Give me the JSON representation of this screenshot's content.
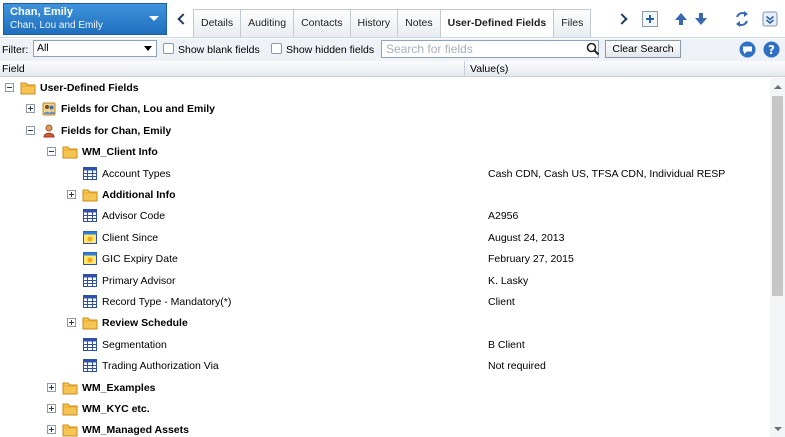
{
  "header": {
    "client_name": "Chan, Emily",
    "client_household": "Chan, Lou and Emily",
    "tabs": [
      {
        "label": "Details"
      },
      {
        "label": "Auditing"
      },
      {
        "label": "Contacts"
      },
      {
        "label": "History"
      },
      {
        "label": "Notes"
      },
      {
        "label": "User-Defined Fields",
        "active": true
      },
      {
        "label": "Files"
      }
    ],
    "icons": [
      "chevron-left-icon",
      "chevron-right-icon",
      "add-tab-icon",
      "arrow-up-icon",
      "arrow-down-icon",
      "refresh-icon",
      "collapse-icon"
    ]
  },
  "filterbar": {
    "filter_label": "Filter:",
    "filter_value": "All",
    "show_blank_label": "Show blank fields",
    "show_hidden_label": "Show hidden fields",
    "search_placeholder": "Search for fields",
    "clear_search_label": "Clear Search"
  },
  "columns": {
    "field": "Field",
    "values": "Value(s)"
  },
  "tree": {
    "rows": [
      {
        "label": "User-Defined Fields",
        "value": "",
        "level": 0,
        "icon": "folder-icon",
        "expander": "minus",
        "bold": true
      },
      {
        "label": "Fields for Chan, Lou and Emily",
        "value": "",
        "level": 1,
        "icon": "household-icon",
        "expander": "plus",
        "bold": true
      },
      {
        "label": "Fields for Chan, Emily",
        "value": "",
        "level": 1,
        "icon": "person-icon",
        "expander": "minus",
        "bold": true
      },
      {
        "label": "WM_Client Info",
        "value": "",
        "level": 2,
        "icon": "folder-icon",
        "expander": "minus",
        "bold": true
      },
      {
        "label": "Account Types",
        "value": "Cash CDN, Cash US, TFSA CDN, Individual RESP",
        "level": 3,
        "icon": "grid-field-icon"
      },
      {
        "label": "Additional Info",
        "value": "",
        "level": 3,
        "icon": "folder-icon",
        "expander": "plus",
        "bold": true
      },
      {
        "label": "Advisor Code",
        "value": "A2956",
        "level": 3,
        "icon": "grid-field-icon"
      },
      {
        "label": "Client Since",
        "value": "August 24, 2013",
        "level": 3,
        "icon": "date-field-icon"
      },
      {
        "label": "GIC Expiry Date",
        "value": "February 27, 2015",
        "level": 3,
        "icon": "date-field-icon"
      },
      {
        "label": "Primary Advisor",
        "value": "K. Lasky",
        "level": 3,
        "icon": "grid-field-icon"
      },
      {
        "label": "Record Type - Mandatory(*)",
        "value": "Client",
        "level": 3,
        "icon": "grid-field-icon"
      },
      {
        "label": "Review Schedule",
        "value": "",
        "level": 3,
        "icon": "folder-icon",
        "expander": "plus",
        "bold": true
      },
      {
        "label": "Segmentation",
        "value": "B Client",
        "level": 3,
        "icon": "grid-field-icon"
      },
      {
        "label": "Trading Authorization Via",
        "value": "Not required",
        "level": 3,
        "icon": "grid-field-icon"
      },
      {
        "label": "WM_Examples",
        "value": "",
        "level": 2,
        "icon": "folder-icon",
        "expander": "plus",
        "bold": true
      },
      {
        "label": "WM_KYC etc.",
        "value": "",
        "level": 2,
        "icon": "folder-icon",
        "expander": "plus",
        "bold": true
      },
      {
        "label": "WM_Managed Assets",
        "value": "",
        "level": 2,
        "icon": "folder-icon",
        "expander": "plus",
        "bold": true
      }
    ]
  },
  "colors": {
    "client_box": "#2a7ccb",
    "folder": "#f2b840",
    "grid_icon": "#2f4fa8",
    "header_bg": "#eef2f6"
  }
}
